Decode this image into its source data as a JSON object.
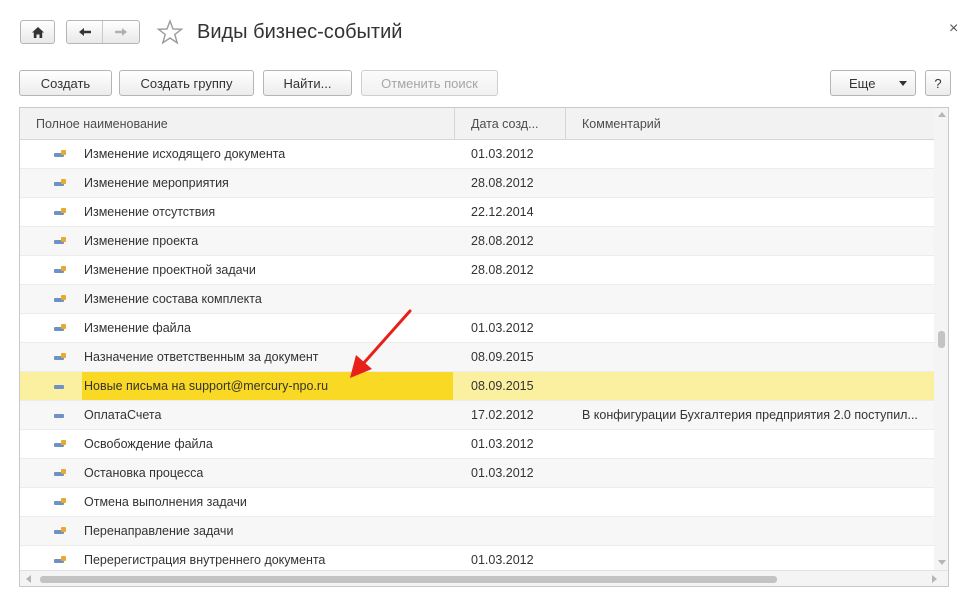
{
  "window": {
    "title": "Виды бизнес-событий",
    "close_glyph": "×"
  },
  "toolbar": {
    "create": "Создать",
    "create_group": "Создать группу",
    "find": "Найти...",
    "cancel_search": "Отменить поиск",
    "more": "Еще",
    "help": "?"
  },
  "table": {
    "columns": [
      "Полное наименование",
      "Дата созд...",
      "Комментарий"
    ],
    "rows": [
      {
        "name": "Изменение исходящего документа",
        "date": "01.03.2012",
        "comment": ""
      },
      {
        "name": "Изменение мероприятия",
        "date": "28.08.2012",
        "comment": ""
      },
      {
        "name": "Изменение отсутствия",
        "date": "22.12.2014",
        "comment": ""
      },
      {
        "name": "Изменение проекта",
        "date": "28.08.2012",
        "comment": ""
      },
      {
        "name": "Изменение проектной задачи",
        "date": "28.08.2012",
        "comment": ""
      },
      {
        "name": "Изменение состава комплекта",
        "date": "",
        "comment": ""
      },
      {
        "name": "Изменение файла",
        "date": "01.03.2012",
        "comment": ""
      },
      {
        "name": "Назначение ответственным за документ",
        "date": "08.09.2015",
        "comment": ""
      },
      {
        "name": "Новые письма на support@mercury-npo.ru",
        "date": "08.09.2015",
        "comment": ""
      },
      {
        "name": "ОплатаСчета",
        "date": "17.02.2012",
        "comment": "В конфигурации Бухгалтерия предприятия 2.0 поступил..."
      },
      {
        "name": "Освобождение файла",
        "date": "01.03.2012",
        "comment": ""
      },
      {
        "name": "Остановка процесса",
        "date": "01.03.2012",
        "comment": ""
      },
      {
        "name": "Отмена выполнения задачи",
        "date": "",
        "comment": ""
      },
      {
        "name": "Перенаправление задачи",
        "date": "",
        "comment": ""
      },
      {
        "name": "Перерегистрация внутреннего документа",
        "date": "01.03.2012",
        "comment": ""
      }
    ]
  },
  "colors": {
    "selected_row": "#fbf0a0",
    "selected_cell": "#f9d923",
    "annotation_arrow": "#e8201a"
  }
}
